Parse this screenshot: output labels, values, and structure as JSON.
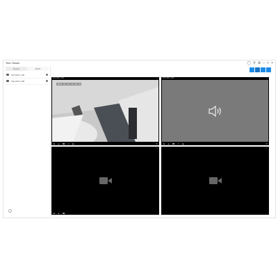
{
  "app": {
    "title": "Tine Owser"
  },
  "window_controls": [
    "shield-icon",
    "search-icon",
    "gear-icon",
    "minimize-icon",
    "maximize-icon",
    "close-icon"
  ],
  "layout_buttons": [
    "layout-1x1",
    "layout-2x2",
    "layout-3x3",
    "layout-4x4"
  ],
  "sidebar": {
    "tabs": [
      {
        "label": "Device"
      },
      {
        "label": "Multiv"
      }
    ],
    "devices": [
      {
        "name": "192.168.1.100"
      },
      {
        "name": "192.168.1.108"
      }
    ]
  },
  "cells": [
    {
      "header": "192.168.1.100",
      "timestamp": "2023-03-28 10:20:45",
      "type": "video"
    },
    {
      "header": "192.168.1.108",
      "type": "audio"
    },
    {
      "header": "",
      "type": "empty"
    },
    {
      "header": "",
      "type": "empty"
    }
  ],
  "colors": {
    "accent": "#1e8ce6",
    "cell_bg": "#000000",
    "audio_bg": "#7a7a7a"
  }
}
